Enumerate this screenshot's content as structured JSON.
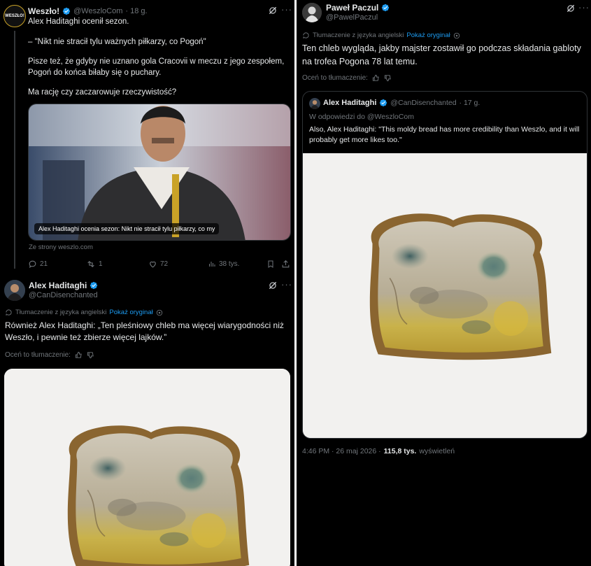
{
  "left": {
    "tweet1": {
      "avatar_text": "WESZŁO!",
      "name": "Weszło!",
      "handle": "@WeszloCom",
      "time": "· 18 g.",
      "line1": "Alex Haditaghi ocenił sezon.",
      "line2": "– \"Nikt nie stracił tylu ważnych piłkarzy, co Pogoń\"",
      "line3": "Pisze też, że gdyby nie uznano gola Cracovii w meczu z jego zespołem, Pogoń do końca biłaby się o puchary.",
      "line4": "Ma rację czy zaczarowuje rzeczywistość?",
      "card_overlay": "Alex Haditaghi ocenia sezon: Nikt nie stracił tylu piłkarzy, co my",
      "card_source": "Ze strony weszlo.com",
      "replies": "21",
      "retweets": "1",
      "likes": "72",
      "views": "38 tys."
    },
    "tweet2": {
      "name": "Alex Haditaghi",
      "handle": "@CanDisenchanted",
      "translated_label": "Tłumaczenie z języka angielski",
      "show_original": "Pokaż oryginał",
      "text": "Również Alex Haditaghi: „Ten pleśniowy chleb ma więcej wiarygodności niż Weszło, i pewnie też zbierze więcej lajków.”",
      "rate_translation": "Oceń to tłumaczenie:"
    }
  },
  "right": {
    "name": "Paweł Paczul",
    "handle": "@PawelPaczul",
    "translated_label": "Tłumaczenie z języka angielski",
    "show_original": "Pokaż oryginał",
    "text": "Ten chleb wygląda, jakby majster zostawił go podczas składania gabloty na trofea Pogona 78 lat temu.",
    "rate_translation": "Oceń to tłumaczenie:",
    "quote": {
      "name": "Alex Haditaghi",
      "handle": "@CanDisenchanted",
      "time": "· 17 g.",
      "reply_to": "W odpowiedzi do @WeszloCom",
      "text": "Also, Alex Haditaghi: \"This moldy bread has more credibility than Weszlo, and it will probably get more likes too.\""
    },
    "footer": {
      "time": "4:46 PM · 26 maj 2026 ·",
      "views_count": "115,8 tys.",
      "views_label": "wyświetleń"
    }
  },
  "colors": {
    "background": "#000000",
    "text": "#e7e9ea",
    "muted": "#71767b",
    "link": "#1d9bf0",
    "verified": "#1d9bf0",
    "border": "#2f3336"
  },
  "icons": [
    "verified-badge-icon",
    "grok-icon",
    "more-icon",
    "reply-icon",
    "retweet-icon",
    "like-icon",
    "views-icon",
    "bookmark-icon",
    "share-icon",
    "translate-icon",
    "info-icon",
    "thumbs-up-icon",
    "thumbs-down-icon"
  ]
}
